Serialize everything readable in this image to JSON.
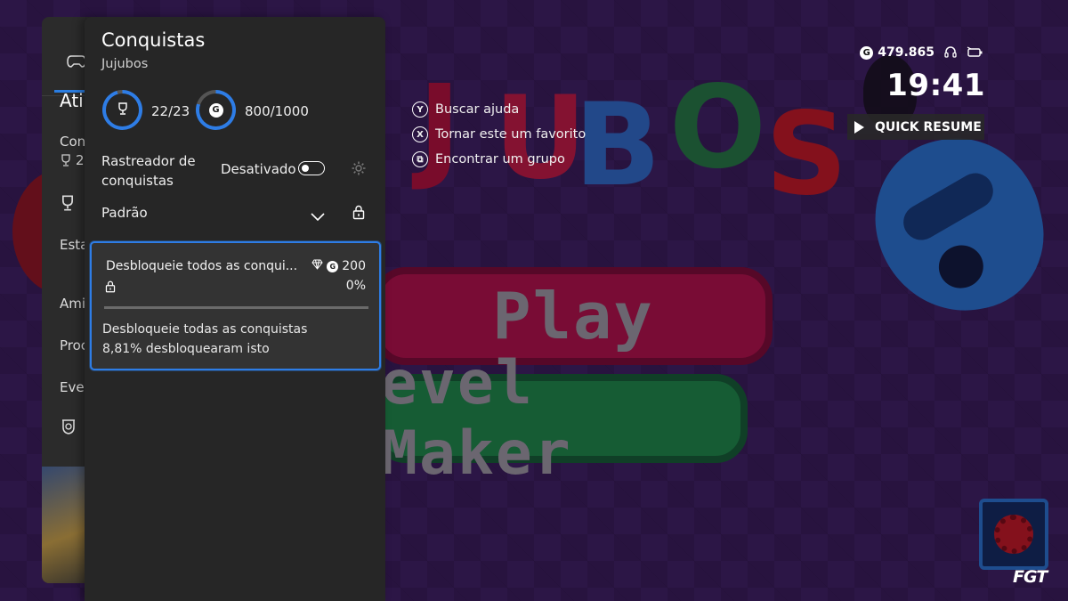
{
  "hud": {
    "gamerscore": "479.865",
    "time": "19:41",
    "quick_resume_label": "QUICK RESUME"
  },
  "game": {
    "logo_text": "JUBOS",
    "play_label": "Play",
    "level_maker_label": "evel Maker"
  },
  "hints": [
    {
      "glyph": "Y",
      "label": "Buscar ajuda"
    },
    {
      "glyph": "X",
      "label": "Tornar este um favorito"
    },
    {
      "glyph": "⧉",
      "label": "Encontrar um grupo"
    }
  ],
  "guide": {
    "items": [
      "Ati",
      "Con",
      "2",
      "Esta",
      "Ami",
      "Proc",
      "Even"
    ]
  },
  "panel": {
    "title": "Conquistas",
    "game_name": "Jujubos",
    "achievements_count": "22/23",
    "achievements_fraction": 0.9565,
    "gamerscore_count": "800/1000",
    "gamerscore_fraction": 0.8,
    "tracker_label": "Rastreador de conquistas",
    "tracker_state": "Desativado",
    "filter_label": "Padrão"
  },
  "achievement": {
    "name": "Desbloqueie todos as conqui...",
    "gamerscore": "200",
    "progress_text": "0%",
    "progress": 0,
    "description": "Desbloqueie todas as conquistas",
    "rarity": "8,81% desbloquearam isto"
  },
  "colors": {
    "accent": "#2e7de6",
    "panel_bg": "#262626",
    "card_bg": "#333333"
  },
  "watermark": "FGT"
}
